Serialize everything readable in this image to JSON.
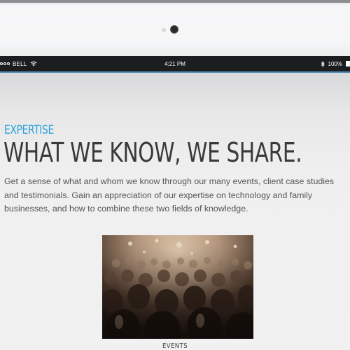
{
  "status_bar": {
    "carrier": "BELL",
    "time": "4:21 PM",
    "battery": "100%",
    "icons": [
      "signal-dots-icon",
      "wifi-icon",
      "bluetooth-icon",
      "battery-icon"
    ]
  },
  "section": {
    "eyebrow": "EXPERTISE",
    "headline": "WHAT WE KNOW, WE SHARE.",
    "intro": "Get a sense of what and whom we know through our many events, client case studies\nand testimonials. Gain an appreciation of our expertise on technology and family\nbusinesses, and how to combine these two fields of knowledge."
  },
  "events_card": {
    "image": "crowd-audience-photo",
    "caption": "EVENTS"
  },
  "colors": {
    "accent": "#2ba1dc",
    "headline": "#3a3a3a",
    "status_bar_bg": "#1c1d1f"
  }
}
